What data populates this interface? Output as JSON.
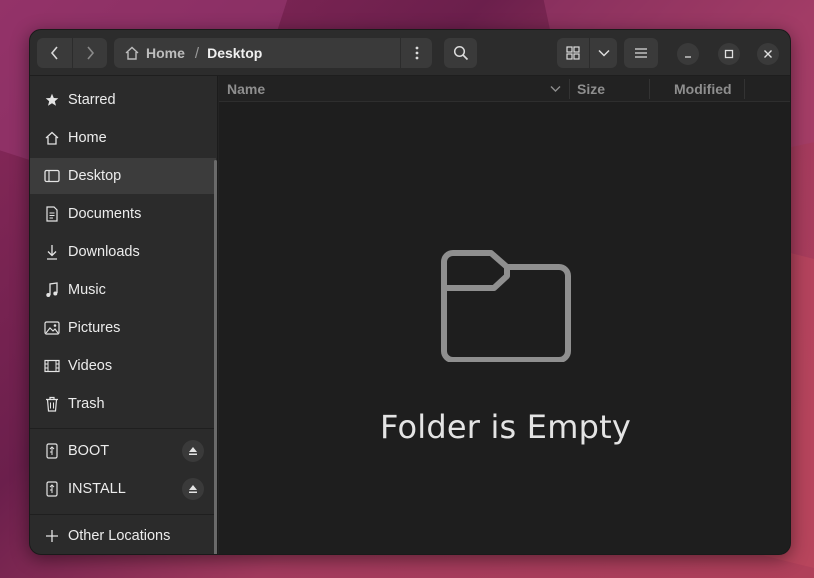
{
  "headerbar": {
    "path": {
      "home_label": "Home",
      "separator": "/",
      "current": "Desktop"
    }
  },
  "columns": {
    "name": "Name",
    "size": "Size",
    "modified": "Modified"
  },
  "sidebar": {
    "items": [
      {
        "label": "Starred",
        "icon": "star-icon"
      },
      {
        "label": "Home",
        "icon": "home-icon"
      },
      {
        "label": "Desktop",
        "icon": "desktop-icon",
        "active": true
      },
      {
        "label": "Documents",
        "icon": "document-icon"
      },
      {
        "label": "Downloads",
        "icon": "download-icon"
      },
      {
        "label": "Music",
        "icon": "music-icon"
      },
      {
        "label": "Pictures",
        "icon": "picture-icon"
      },
      {
        "label": "Videos",
        "icon": "video-icon"
      },
      {
        "label": "Trash",
        "icon": "trash-icon"
      }
    ],
    "devices": [
      {
        "label": "BOOT",
        "icon": "usb-drive-icon"
      },
      {
        "label": "INSTALL",
        "icon": "usb-drive-icon"
      }
    ],
    "other_locations": "Other Locations"
  },
  "main": {
    "empty_message": "Folder is Empty"
  },
  "colors": {
    "window_bg": "#242424",
    "sidebar_bg": "#2b2b2b",
    "active_item": "#3c3c3c",
    "text": "#ececec"
  }
}
